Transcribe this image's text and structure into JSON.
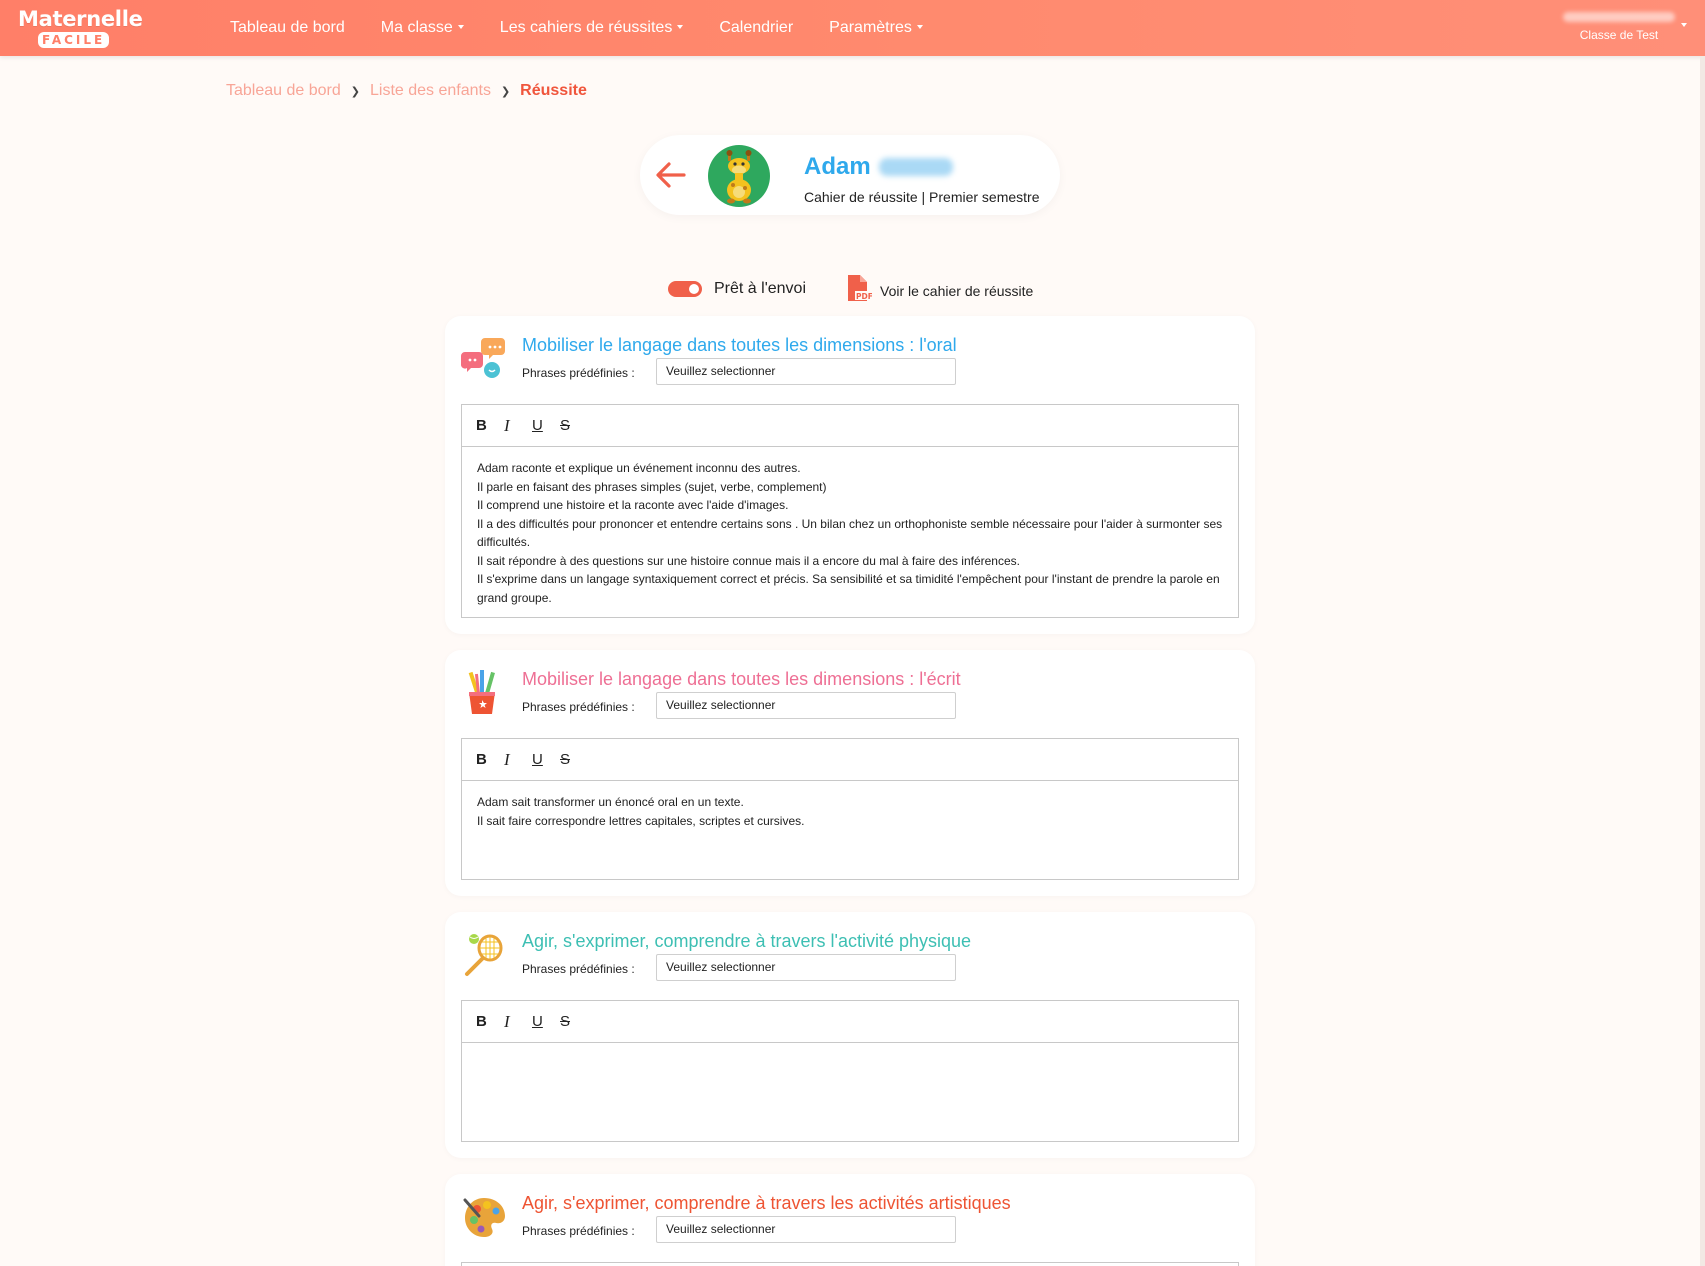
{
  "nav": {
    "logo_line1": "Maternelle",
    "logo_line2": "FACILE",
    "items": [
      {
        "label": "Tableau de bord"
      },
      {
        "label": "Ma classe"
      },
      {
        "label": "Les cahiers de réussites"
      },
      {
        "label": "Calendrier"
      },
      {
        "label": "Paramètres"
      }
    ],
    "user_class": "Classe de Test"
  },
  "breadcrumb": {
    "items": [
      "Tableau de bord",
      "Liste des enfants"
    ],
    "current": "Réussite"
  },
  "student": {
    "first_name": "Adam",
    "subtitle": "Cahier de réussite | Premier semestre"
  },
  "actions": {
    "ready_label": "Prêt à l'envoi",
    "ready_on": true,
    "pdf_label": "Voir le cahier de réussite"
  },
  "editor_buttons": {
    "bold": "B",
    "italic": "I",
    "underline": "U",
    "strike": "S"
  },
  "sections": [
    {
      "title": "Mobiliser le langage dans toutes les dimensions : l'oral",
      "title_color": "#2fa9ec",
      "icon": "speech-bubbles-icon",
      "phrases_label": "Phrases prédéfinies :",
      "select_value": "Veuillez selectionner",
      "text": [
        "Adam raconte et explique un événement inconnu des autres.",
        "Il parle en faisant des phrases simples (sujet, verbe, complement)",
        "Il comprend une histoire et la raconte avec l'aide d'images.",
        "Il a des difficultés pour prononcer et entendre certains sons . Un bilan chez un orthophoniste semble nécessaire pour l'aider à surmonter ses difficultés.",
        "Il sait répondre à des questions sur une histoire connue mais il a encore du mal à faire des inférences.",
        "Il s'exprime dans un langage syntaxiquement correct et précis. Sa sensibilité et sa timidité l'empêchent pour l'instant de prendre la parole en grand groupe."
      ]
    },
    {
      "title": "Mobiliser le langage dans toutes les dimensions : l'écrit",
      "title_color": "#ee6f94",
      "icon": "pencil-cup-icon",
      "phrases_label": "Phrases prédéfinies :",
      "select_value": "Veuillez selectionner",
      "text": [
        "Adam sait transformer un énoncé oral en un texte.",
        "Il sait faire correspondre lettres capitales, scriptes et cursives."
      ]
    },
    {
      "title": "Agir, s'exprimer, comprendre à travers l'activité physique",
      "title_color": "#3dbfb3",
      "icon": "racket-icon",
      "phrases_label": "Phrases prédéfinies :",
      "select_value": "Veuillez selectionner",
      "text": []
    },
    {
      "title": "Agir, s'exprimer, comprendre à travers les activités artistiques",
      "title_color": "#ee5433",
      "icon": "palette-icon",
      "phrases_label": "Phrases prédéfinies :",
      "select_value": "Veuillez selectionner",
      "text": []
    }
  ]
}
